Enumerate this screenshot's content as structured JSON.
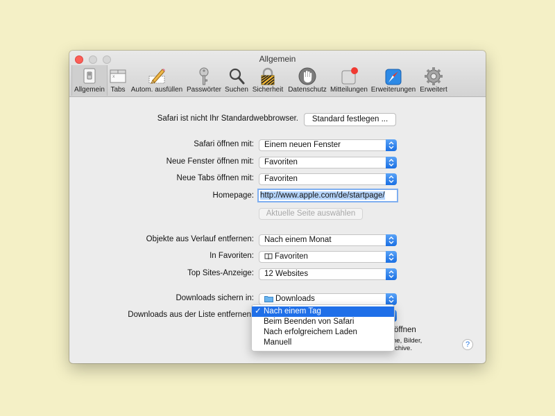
{
  "window": {
    "title": "Allgemein"
  },
  "toolbar": {
    "items": [
      {
        "label": "Allgemein",
        "icon": "general-switch-icon",
        "active": true
      },
      {
        "label": "Tabs",
        "icon": "tabs-icon"
      },
      {
        "label": "Autom. ausfüllen",
        "icon": "pencil-icon"
      },
      {
        "label": "Passwörter",
        "icon": "key-icon"
      },
      {
        "label": "Suchen",
        "icon": "magnifier-icon"
      },
      {
        "label": "Sicherheit",
        "icon": "lock-icon"
      },
      {
        "label": "Datenschutz",
        "icon": "hand-icon"
      },
      {
        "label": "Mitteilungen",
        "icon": "notifications-icon"
      },
      {
        "label": "Erweiterungen",
        "icon": "extensions-compass-icon"
      },
      {
        "label": "Erweitert",
        "icon": "gear-icon"
      }
    ]
  },
  "default_browser": {
    "text": "Safari ist nicht Ihr Standardwebbrowser.",
    "button": "Standard festlegen ..."
  },
  "settings": {
    "open_with": {
      "label": "Safari öffnen mit:",
      "value": "Einem neuen Fenster"
    },
    "new_windows": {
      "label": "Neue Fenster öffnen mit:",
      "value": "Favoriten"
    },
    "new_tabs": {
      "label": "Neue Tabs öffnen mit:",
      "value": "Favoriten"
    },
    "homepage": {
      "label": "Homepage:",
      "value": "http://www.apple.com/de/startpage/"
    },
    "current_page_button": "Aktuelle Seite auswählen",
    "remove_history": {
      "label": "Objekte aus Verlauf entfernen:",
      "value": "Nach einem Monat"
    },
    "favorites": {
      "label": "In Favoriten:",
      "value": "Favoriten",
      "icon": "book-icon"
    },
    "top_sites": {
      "label": "Top Sites-Anzeige:",
      "value": "12 Websites"
    },
    "downloads_location": {
      "label": "Downloads sichern in:",
      "value": "Downloads",
      "icon": "folder-icon"
    },
    "remove_downloads": {
      "label": "Downloads aus der Liste entfernen",
      "options": [
        "Nach einem Tag",
        "Beim Beenden von Safari",
        "Nach erfolgreichem Laden",
        "Manuell"
      ],
      "selected_index": 0
    },
    "obscured_text": {
      "line1": "öffnen",
      "line2": "ne, Bilder,",
      "line3": "rchive."
    }
  },
  "help": {
    "label": "?"
  },
  "colors": {
    "accent": "#1f6fe8",
    "close": "#fc5f57",
    "background": "#f4f0c6"
  }
}
